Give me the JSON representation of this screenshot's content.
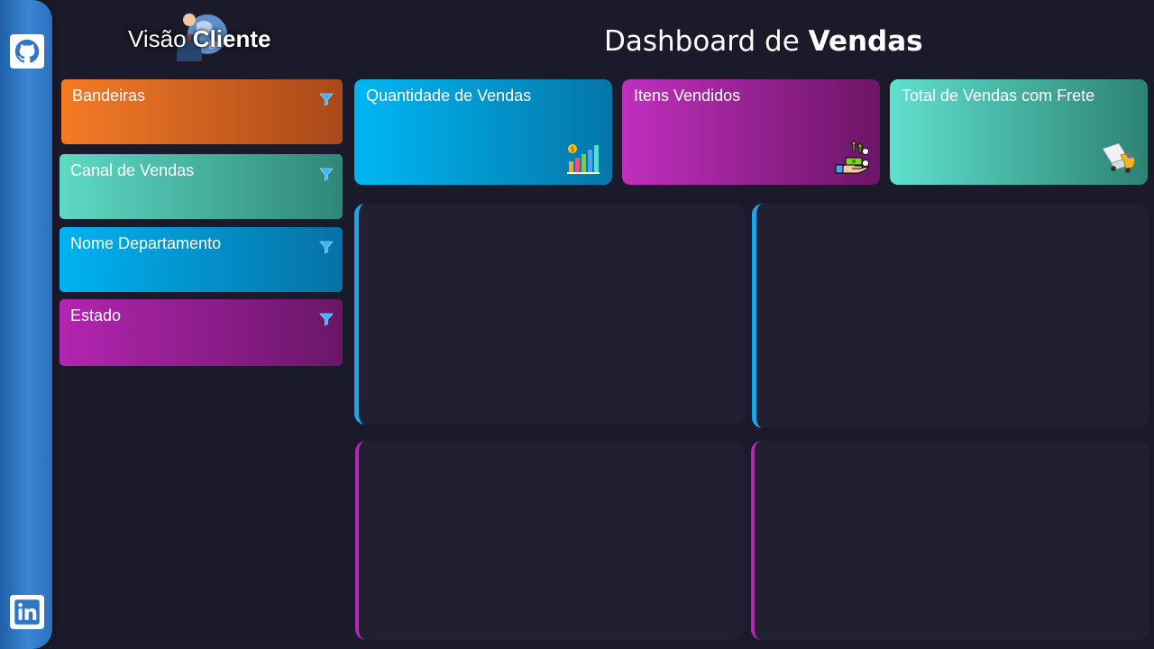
{
  "rail": {
    "top_icon": "github-icon",
    "bottom_icon": "linkedin-icon"
  },
  "brand": {
    "prefix": "Visão ",
    "emphasis": "Cliente"
  },
  "title": {
    "prefix": "Dashboard de ",
    "emphasis": "Vendas"
  },
  "filters": [
    {
      "label": "Bandeiras",
      "color": "#f47b25"
    },
    {
      "label": "Canal de Vendas",
      "color": "#5ed9c4"
    },
    {
      "label": "Nome Departamento",
      "color": "#00b2f1"
    },
    {
      "label": "Estado",
      "color": "#b225b0"
    }
  ],
  "kpis": [
    {
      "label": "Quantidade de Vendas",
      "icon": "bar-chart-icon"
    },
    {
      "label": "Itens Vendidos",
      "icon": "money-hand-icon"
    },
    {
      "label": "Total de Vendas com Frete",
      "icon": "delivery-truck-icon"
    }
  ],
  "colors": {
    "background": "#1b1a2a",
    "panel": "#211f31",
    "accent_blue": "#1aa7ea",
    "accent_magenta": "#b328b2"
  }
}
